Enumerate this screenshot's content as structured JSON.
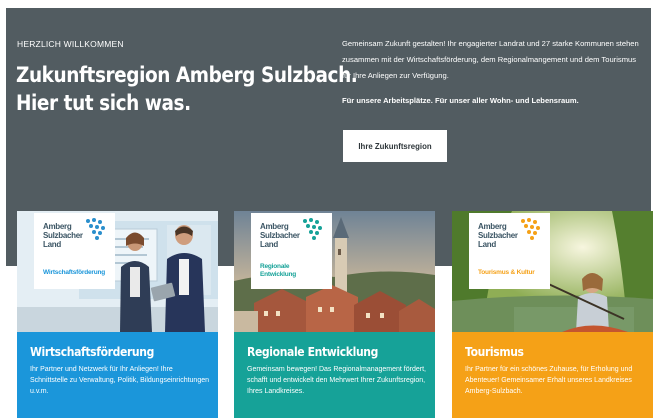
{
  "hero": {
    "eyebrow": "HERZLICH WILLKOMMEN",
    "headline_line1": "Zukunftsregion Amberg Sulzbach.",
    "headline_line2": "Hier tut sich was.",
    "intro": "Gemeinsam Zukunft gestalten! Ihr engagierter Landrat und 27 starke Kommunen stehen zusammen mit der Wirtschaftsförderung, dem Regionalmangement und dem Tourismus für Ihre Anliegen zur Verfügung.",
    "intro_bold": "Für unsere Arbeitsplätze. Für unser aller Wohn- und Lebensraum.",
    "cta_label": "Ihre Zukunftsregion"
  },
  "logo": {
    "line1": "Amberg",
    "line2": "Sulzbacher",
    "line3": "Land"
  },
  "cards": [
    {
      "sub": "Wirtschaftsförderung",
      "title": "Wirtschaftsförderung",
      "text": "Ihr Partner und Netzwerk für Ihr Anliegen! Ihre Schnittstelle zu Verwaltung, Politik, Bildungseinrichtungen u.v.m.",
      "color": "#1b96da"
    },
    {
      "sub1": "Regionale",
      "sub2": "Entwicklung",
      "title": "Regionale Entwicklung",
      "text": "Gemeinsam bewegen! Das Regionalmanagement fördert, schafft und entwickelt den Mehrwert Ihrer Zukunftsregion, Ihres Landkreises.",
      "color": "#16a298"
    },
    {
      "sub": "Tourismus & Kultur",
      "title": "Tourismus",
      "text": "Ihr Partner für ein schönes Zuhause, für Erholung und Abenteuer! Gemeinsamer Erhalt unseres Landkreises Amberg-Sulzbach.",
      "color": "#f5a117"
    }
  ]
}
